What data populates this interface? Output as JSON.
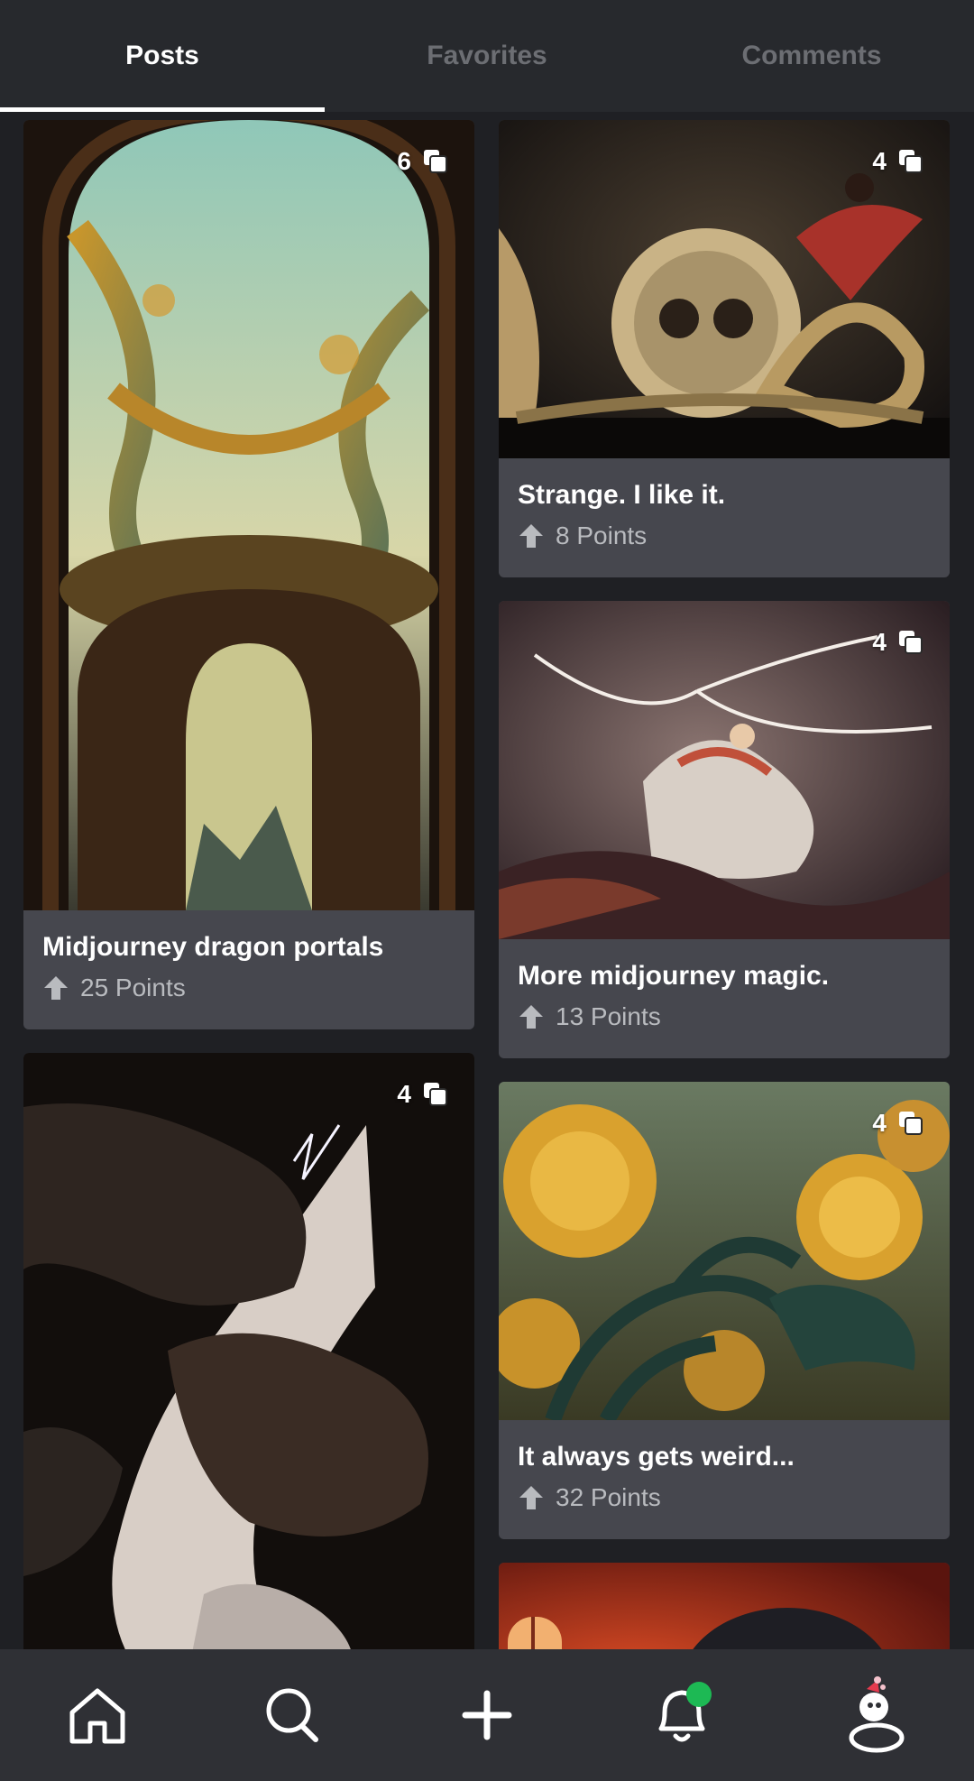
{
  "tabs": [
    {
      "label": "Posts",
      "active": true
    },
    {
      "label": "Favorites",
      "active": false
    },
    {
      "label": "Comments",
      "active": false
    }
  ],
  "posts": [
    {
      "title": "Midjourney dragon portals",
      "points": "25 Points",
      "image_count": "6",
      "image_desc": "dragon-portal-art"
    },
    {
      "title": "Strange. I like it.",
      "points": "8 Points",
      "image_count": "4",
      "image_desc": "skull-sculpture-art"
    },
    {
      "title": "More midjourney magic.",
      "points": "13 Points",
      "image_count": "4",
      "image_desc": "ethereal-figure-art"
    },
    {
      "title": "",
      "points": "",
      "image_count": "4",
      "image_desc": "storm-tree-art"
    },
    {
      "title": "It always gets weird...",
      "points": "32 Points",
      "image_count": "4",
      "image_desc": "marigold-flowers-art"
    }
  ],
  "bottom_nav": [
    {
      "icon": "home-icon"
    },
    {
      "icon": "search-icon"
    },
    {
      "icon": "plus-icon"
    },
    {
      "icon": "bell-icon",
      "has_notification": true
    },
    {
      "icon": "avatar-icon"
    }
  ],
  "colors": {
    "background": "#27292d",
    "card": "#46474e",
    "notification_dot": "#1db954"
  }
}
